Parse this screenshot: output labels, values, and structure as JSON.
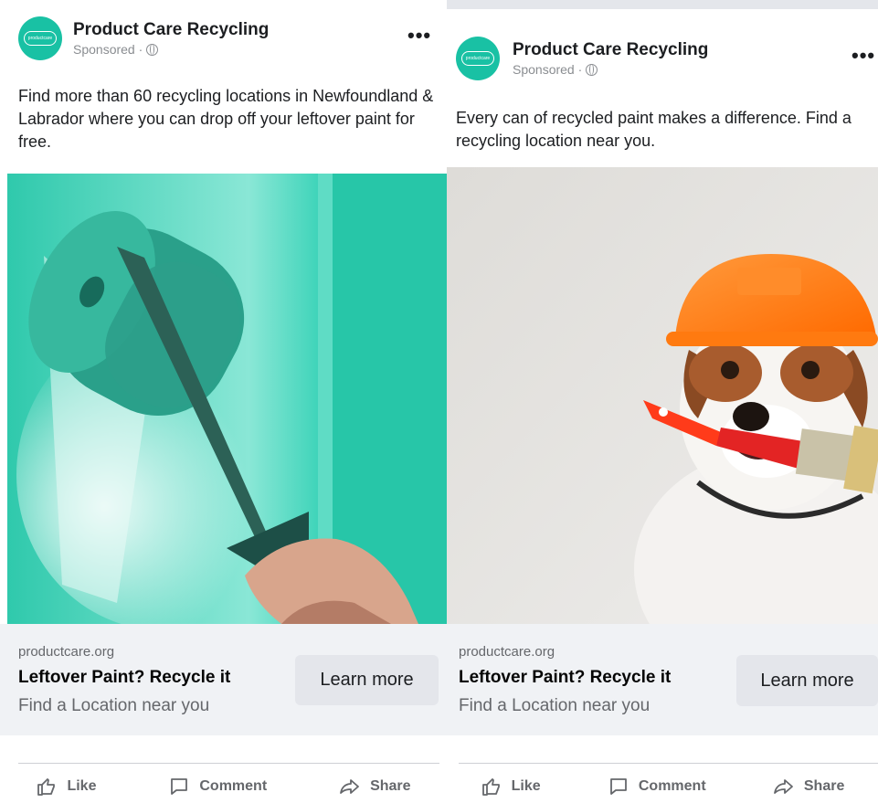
{
  "posts": [
    {
      "page_name": "Product Care Recycling",
      "sponsored": "Sponsored ·",
      "avatar_text": "productcare",
      "caption": "Find more than 60 recycling locations in Newfoundland & Labrador where you can drop off your leftover paint for free.",
      "domain": "productcare.org",
      "headline": "Leftover Paint? Recycle it",
      "description": "Find a Location near you",
      "cta": "Learn more",
      "actions": {
        "like": "Like",
        "comment": "Comment",
        "share": "Share"
      }
    },
    {
      "page_name": "Product Care Recycling",
      "sponsored": "Sponsored ·",
      "avatar_text": "productcare",
      "caption": "Every can of recycled paint makes a difference. Find a recycling location near you.",
      "domain": "productcare.org",
      "headline": "Leftover Paint? Recycle it",
      "description": "Find a Location near you",
      "cta": "Learn more",
      "actions": {
        "like": "Like",
        "comment": "Comment",
        "share": "Share"
      }
    }
  ],
  "icons": [
    "globe-icon",
    "more-options-icon",
    "like-icon",
    "comment-icon",
    "share-icon"
  ],
  "colors": {
    "brand": "#19c1a4",
    "wall": "#32d1b4",
    "helmet": "#ff7a1a"
  }
}
